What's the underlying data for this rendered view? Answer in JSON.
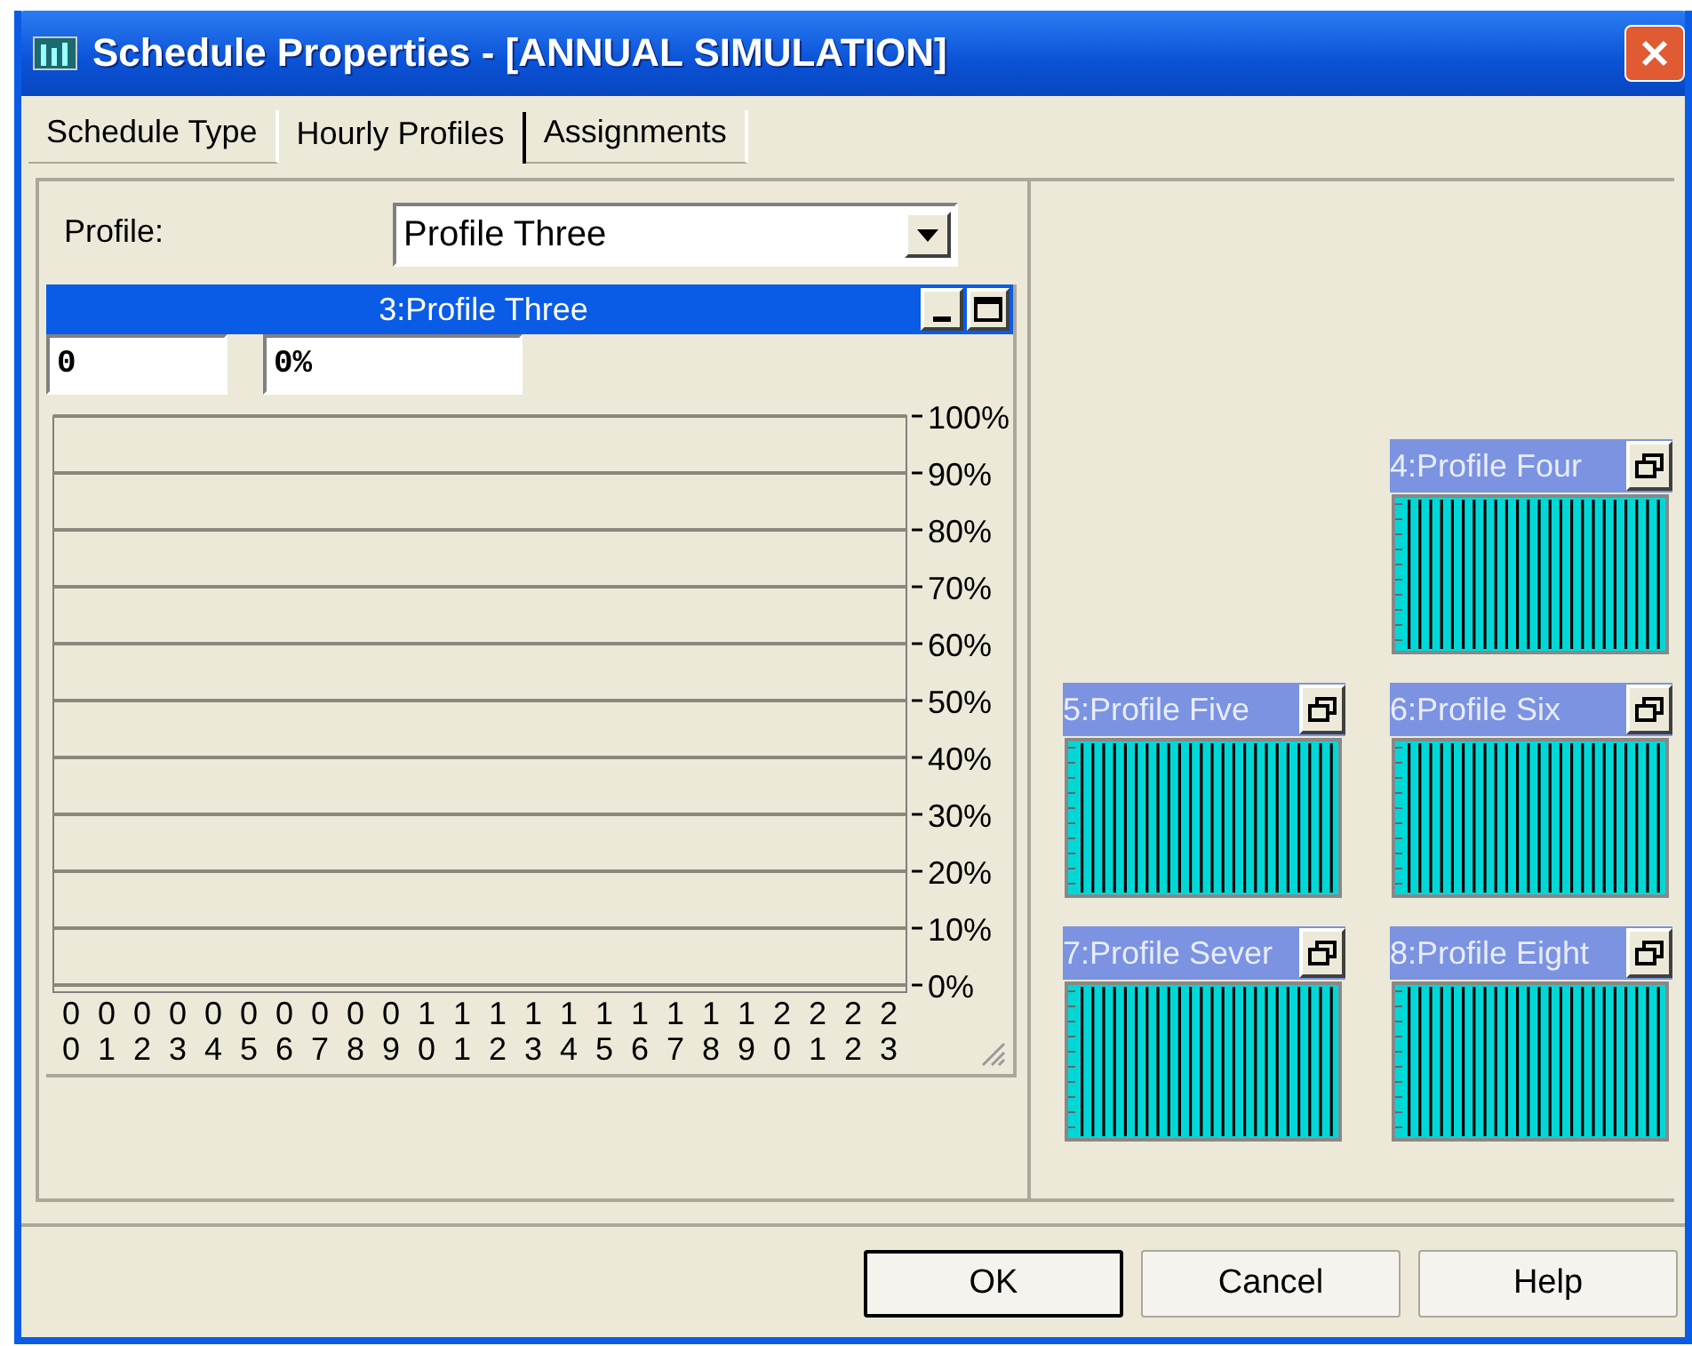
{
  "window": {
    "title": "Schedule Properties - [ANNUAL SIMULATION]"
  },
  "tabs": [
    {
      "label": "Schedule Type",
      "selected": false
    },
    {
      "label": "Hourly Profiles",
      "selected": true
    },
    {
      "label": "Assignments",
      "selected": false
    }
  ],
  "profile_field": {
    "label": "Profile:",
    "value": "Profile Three"
  },
  "active_profile": {
    "title": "3:Profile Three",
    "hour_value": "0",
    "percent_value": "0%",
    "chart_data": {
      "type": "bar",
      "categories": [
        "00",
        "01",
        "02",
        "03",
        "04",
        "05",
        "06",
        "07",
        "08",
        "09",
        "10",
        "11",
        "12",
        "13",
        "14",
        "15",
        "16",
        "17",
        "18",
        "19",
        "20",
        "21",
        "22",
        "23"
      ],
      "values": [
        0,
        0,
        0,
        0,
        0,
        0,
        0,
        0,
        0,
        0,
        0,
        0,
        0,
        0,
        0,
        0,
        0,
        0,
        0,
        0,
        0,
        0,
        0,
        0
      ],
      "ylim": [
        0,
        100
      ],
      "grid": true,
      "yticks": [
        {
          "value": 100,
          "label": "100%"
        },
        {
          "value": 90,
          "label": "90%"
        },
        {
          "value": 80,
          "label": "80%"
        },
        {
          "value": 70,
          "label": "70%"
        },
        {
          "value": 60,
          "label": "60%"
        },
        {
          "value": 50,
          "label": "50%"
        },
        {
          "value": 40,
          "label": "40%"
        },
        {
          "value": 30,
          "label": "30%"
        },
        {
          "value": 20,
          "label": "20%"
        },
        {
          "value": 10,
          "label": "10%"
        },
        {
          "value": 0,
          "label": "0%"
        }
      ]
    }
  },
  "minimized_profiles": [
    {
      "title": "4:Profile Four"
    },
    {
      "title": "5:Profile Five"
    },
    {
      "title": "6:Profile Six"
    },
    {
      "title": "7:Profile Sever"
    },
    {
      "title": "8:Profile Eight"
    }
  ],
  "buttons": [
    {
      "label": "OK",
      "default": true
    },
    {
      "label": "Cancel",
      "default": false
    },
    {
      "label": "Help",
      "default": false
    }
  ]
}
